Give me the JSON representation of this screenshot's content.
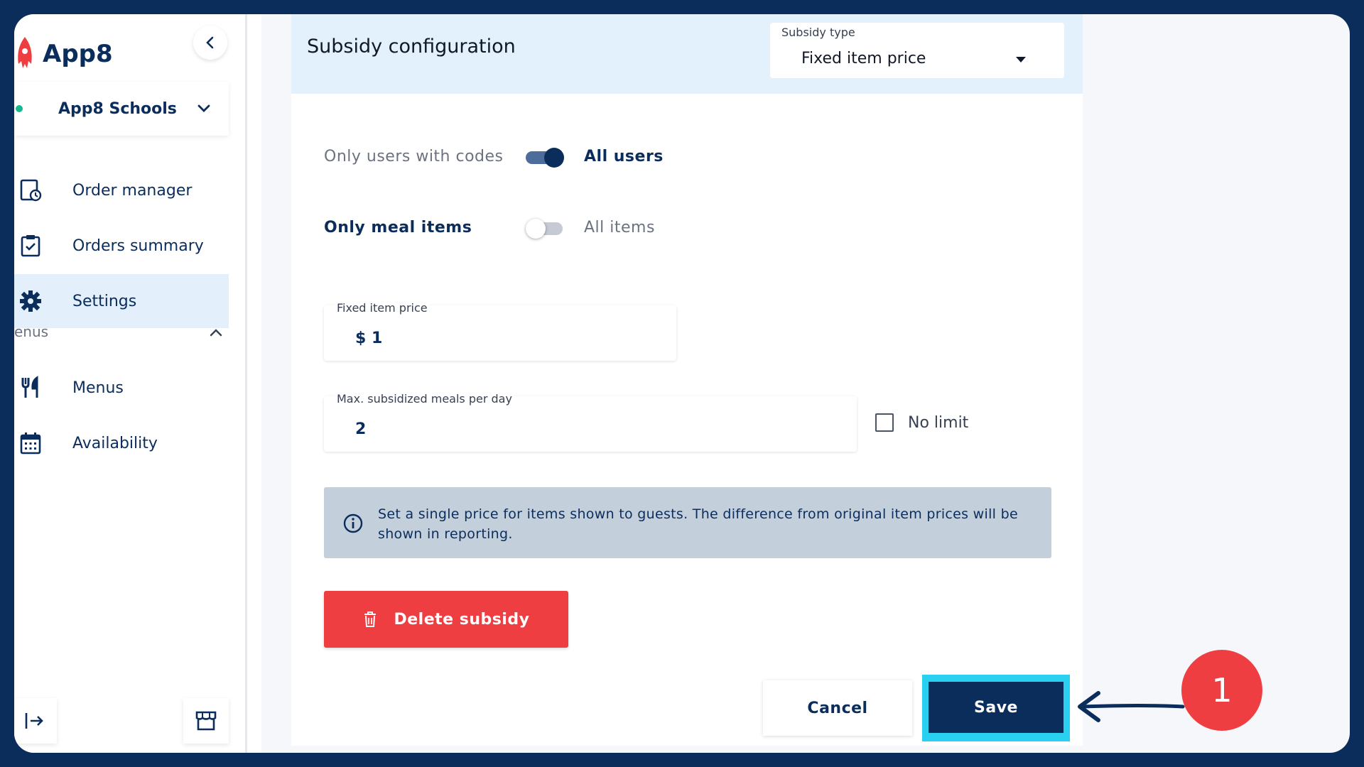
{
  "app": {
    "name": "App8"
  },
  "sidebar": {
    "org": "App8 Schools",
    "items": [
      {
        "label": "Order manager"
      },
      {
        "label": "Orders summary"
      },
      {
        "label": "Settings"
      },
      {
        "label": "Menus"
      },
      {
        "label": "Availability"
      }
    ],
    "section_label": "enus"
  },
  "card": {
    "title": "Subsidy configuration",
    "subsidy_type": {
      "label": "Subsidy type",
      "value": "Fixed item price"
    },
    "toggles": [
      {
        "left": "Only users with codes",
        "right": "All users",
        "on": true
      },
      {
        "left": "Only meal items",
        "right": "All items",
        "on": false
      }
    ],
    "fixed_price": {
      "label": "Fixed item price",
      "value": "$ 1"
    },
    "max_meals": {
      "label": "Max. subsidized meals per day",
      "value": "2"
    },
    "no_limit": {
      "label": "No limit",
      "checked": false
    },
    "info": "Set a single price for items shown to guests. The difference from original item prices will be shown in reporting.",
    "delete_label": "Delete subsidy",
    "cancel_label": "Cancel",
    "save_label": "Save"
  },
  "annotation": {
    "step": "1"
  },
  "colors": {
    "navy": "#0b2d5c",
    "danger": "#ef3e42",
    "highlight": "#29d0ef",
    "active_bg": "#e3effb",
    "info_bg": "#c4cfdc"
  }
}
